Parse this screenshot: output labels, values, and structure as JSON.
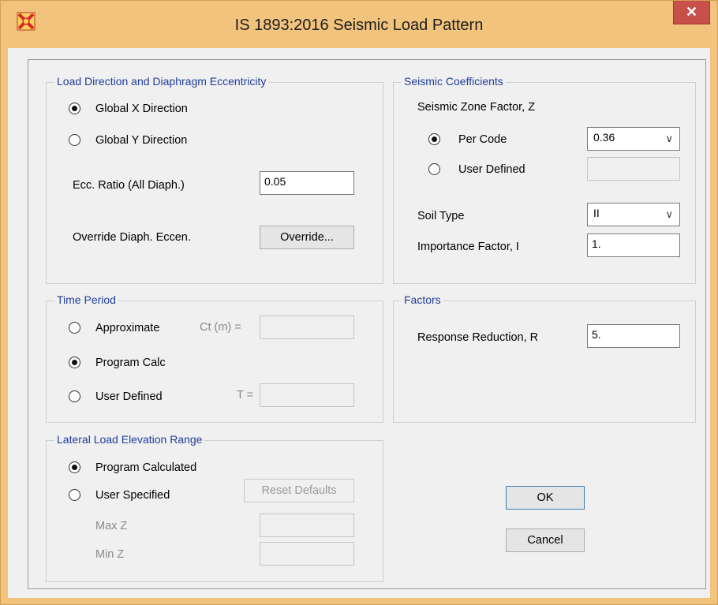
{
  "window": {
    "title": "IS 1893:2016 Seismic Load Pattern",
    "close_label": "✕"
  },
  "load_direction": {
    "legend": "Load Direction and Diaphragm Eccentricity",
    "global_x": "Global  X  Direction",
    "global_y": "Global  Y  Direction",
    "selected": "global_x",
    "ecc_label": "Ecc. Ratio (All Diaph.)",
    "ecc_value": "0.05",
    "override_label": "Override Diaph. Eccen.",
    "override_button": "Override..."
  },
  "seismic_coefficients": {
    "legend": "Seismic Coefficients",
    "zone_label": "Seismic Zone Factor, Z",
    "per_code": "Per Code",
    "user_defined": "User Defined",
    "zone_selected": "per_code",
    "zone_value": "0.36",
    "user_value": "",
    "soil_label": "Soil Type",
    "soil_value": "II",
    "importance_label": "Importance Factor, I",
    "importance_value": "1."
  },
  "time_period": {
    "legend": "Time Period",
    "approximate": "Approximate",
    "ct_label": "Ct (m) =",
    "ct_value": "",
    "program_calc": "Program Calc",
    "user_defined": "User Defined",
    "t_label": "T =",
    "t_value": "",
    "selected": "program_calc"
  },
  "factors": {
    "legend": "Factors",
    "response_label": "Response Reduction, R",
    "response_value": "5."
  },
  "lateral_load": {
    "legend": "Lateral Load Elevation Range",
    "program_calculated": "Program Calculated",
    "user_specified": "User Specified",
    "selected": "program_calculated",
    "reset_button": "Reset Defaults",
    "max_label": "Max Z",
    "max_value": "",
    "min_label": "Min Z",
    "min_value": ""
  },
  "buttons": {
    "ok": "OK",
    "cancel": "Cancel"
  },
  "colors": {
    "title_bar": "#f2c37d",
    "close_button": "#c7504b",
    "legend_text": "#1f3d9b"
  }
}
